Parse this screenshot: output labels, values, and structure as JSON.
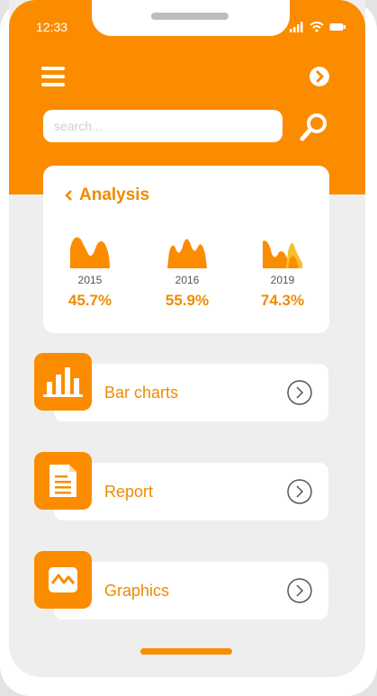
{
  "status_bar": {
    "time": "12:33"
  },
  "search": {
    "placeholder": "search..."
  },
  "analysis": {
    "title": "Analysis",
    "stats": [
      {
        "year": "2015",
        "percent": "45.7%"
      },
      {
        "year": "2016",
        "percent": "55.9%"
      },
      {
        "year": "2019",
        "percent": "74.3%"
      }
    ]
  },
  "menu": [
    {
      "label": "Bar charts",
      "icon": "bar-chart-icon"
    },
    {
      "label": "Report",
      "icon": "document-icon"
    },
    {
      "label": "Graphics",
      "icon": "graphic-icon"
    }
  ],
  "colors": {
    "accent": "#fb8c00",
    "accent_text": "#f08a00",
    "background": "#eeeeee"
  }
}
